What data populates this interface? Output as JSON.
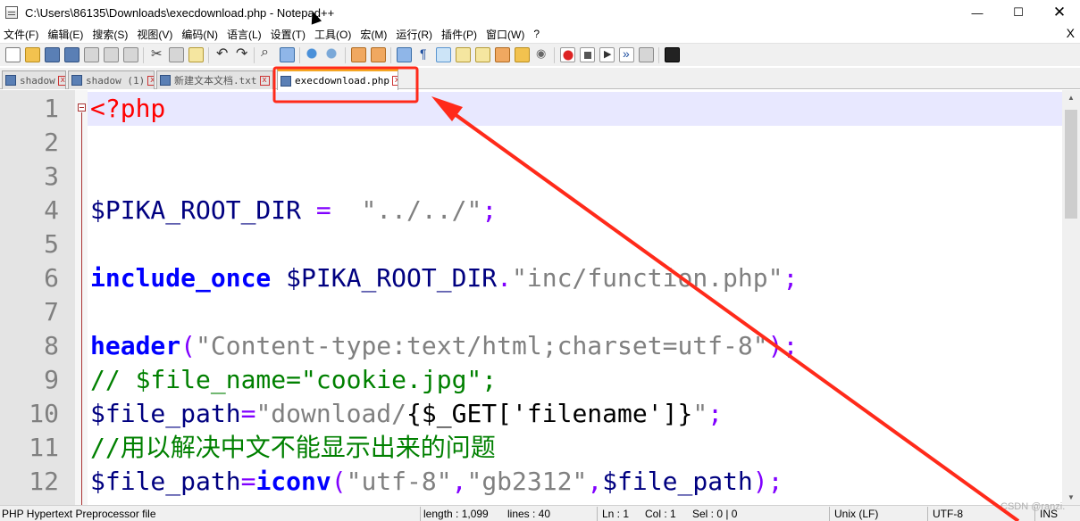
{
  "window": {
    "title": "C:\\Users\\86135\\Downloads\\execdownload.php - Notepad++",
    "minimize_symbol": "—",
    "maximize_symbol": "☐",
    "close_symbol": "✕"
  },
  "menu": {
    "items": [
      "文件(F)",
      "编辑(E)",
      "搜索(S)",
      "视图(V)",
      "编码(N)",
      "语言(L)",
      "设置(T)",
      "工具(O)",
      "宏(M)",
      "运行(R)",
      "插件(P)",
      "窗口(W)",
      "?"
    ],
    "close_doc": "X"
  },
  "toolbar": {
    "icons": [
      "new-file-icon",
      "open-file-icon",
      "save-icon",
      "save-all-icon",
      "close-icon",
      "close-all-icon",
      "print-icon",
      "cut-icon",
      "copy-icon",
      "paste-icon",
      "undo-icon",
      "redo-icon",
      "find-icon",
      "replace-icon",
      "zoom-in-icon",
      "zoom-out-icon",
      "sync-vertical-icon",
      "sync-horizontal-icon",
      "word-wrap-icon",
      "show-all-chars-icon",
      "indent-guide-icon",
      "user-language-icon",
      "doc-map-icon",
      "function-list-icon",
      "folder-workspace-icon",
      "monitoring-icon",
      "record-macro-icon",
      "stop-macro-icon",
      "play-macro-icon",
      "run-macro-multiple-icon",
      "save-macro-icon",
      "console-icon"
    ]
  },
  "tabs": [
    {
      "label": "shadow",
      "active": false
    },
    {
      "label": "shadow (1)",
      "active": false
    },
    {
      "label": "新建文本文档.txt",
      "active": false
    },
    {
      "label": "execdownload.php",
      "active": true
    }
  ],
  "editor": {
    "line_numbers": [
      "1",
      "2",
      "3",
      "4",
      "5",
      "6",
      "7",
      "8",
      "9",
      "10",
      "11",
      "12"
    ],
    "current_line": 1,
    "lines": [
      [
        {
          "t": "<?php",
          "c": "php"
        }
      ],
      [],
      [],
      [
        {
          "t": "$PIKA_ROOT_DIR",
          "c": "var"
        },
        {
          "t": " = ",
          "c": "op"
        },
        {
          "t": " \"../../\"",
          "c": "str"
        },
        {
          "t": ";",
          "c": "op"
        }
      ],
      [],
      [
        {
          "t": "include_once",
          "c": "kw"
        },
        {
          "t": " $PIKA_ROOT_DIR",
          "c": "var"
        },
        {
          "t": ".",
          "c": "op"
        },
        {
          "t": "\"inc/function.php\"",
          "c": "str"
        },
        {
          "t": ";",
          "c": "op"
        }
      ],
      [],
      [
        {
          "t": "header",
          "c": "kw"
        },
        {
          "t": "(",
          "c": "op"
        },
        {
          "t": "\"Content-type:text/html;charset=utf-8\"",
          "c": "str"
        },
        {
          "t": ");",
          "c": "op"
        }
      ],
      [
        {
          "t": "// $file_name=\"cookie.jpg\";",
          "c": "cmt"
        }
      ],
      [
        {
          "t": "$file_path",
          "c": "var"
        },
        {
          "t": "=",
          "c": "op"
        },
        {
          "t": "\"download/",
          "c": "str"
        },
        {
          "t": "{$_GET['filename']}",
          "c": "plain"
        },
        {
          "t": "\"",
          "c": "str"
        },
        {
          "t": ";",
          "c": "op"
        }
      ],
      [
        {
          "t": "//用以解决中文不能显示出来的问题",
          "c": "cmt"
        }
      ],
      [
        {
          "t": "$file_path",
          "c": "var"
        },
        {
          "t": "=",
          "c": "op"
        },
        {
          "t": "iconv",
          "c": "kw"
        },
        {
          "t": "(",
          "c": "op"
        },
        {
          "t": "\"utf-8\"",
          "c": "str"
        },
        {
          "t": ",",
          "c": "op"
        },
        {
          "t": "\"gb2312\"",
          "c": "str"
        },
        {
          "t": ",",
          "c": "op"
        },
        {
          "t": "$file_path",
          "c": "var"
        },
        {
          "t": ");",
          "c": "op"
        }
      ]
    ]
  },
  "statusbar": {
    "file_type": "PHP Hypertext Preprocessor file",
    "length": "length : 1,099",
    "lines": "lines : 40",
    "ln": "Ln : 1",
    "col": "Col : 1",
    "sel": "Sel : 0 | 0",
    "eol": "Unix (LF)",
    "encoding": "UTF-8",
    "ins": "INS"
  },
  "watermark": "CSDN @ranzi.",
  "annotation": {
    "color": "#ff2a1a"
  }
}
